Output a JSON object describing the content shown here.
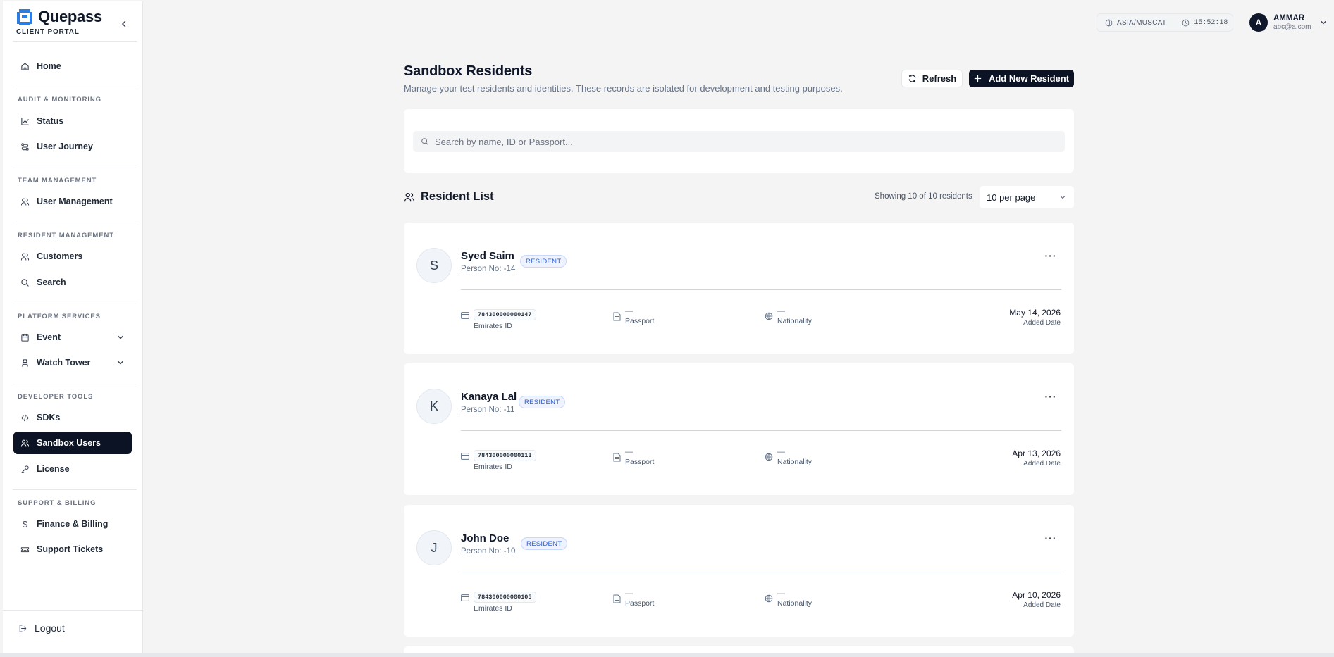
{
  "brand": {
    "name": "Quepass",
    "subtitle": "CLIENT PORTAL"
  },
  "sidebar": {
    "home": "Home",
    "sections": {
      "audit": "AUDIT & MONITORING",
      "team": "TEAM MANAGEMENT",
      "resident": "RESIDENT MANAGEMENT",
      "platform": "PLATFORM SERVICES",
      "developer": "DEVELOPER TOOLS",
      "support": "SUPPORT & BILLING"
    },
    "items": {
      "status": "Status",
      "user_journey": "User Journey",
      "user_management": "User Management",
      "customers": "Customers",
      "search": "Search",
      "event": "Event",
      "watch_tower": "Watch Tower",
      "sdks": "SDKs",
      "sandbox_users": "Sandbox Users",
      "license": "License",
      "finance_billing": "Finance & Billing",
      "support_tickets": "Support Tickets"
    },
    "active": "sandbox_users",
    "logout": "Logout"
  },
  "topbar": {
    "timezone": "ASIA/MUSCAT",
    "time": "15:52:18",
    "user": {
      "initial": "A",
      "name": "AMMAR",
      "email": "abc@a.com"
    }
  },
  "header": {
    "title": "Sandbox Residents",
    "subtitle": "Manage your test residents and identities. These records are isolated for development and testing purposes.",
    "refresh_label": "Refresh",
    "add_label": "Add New Resident"
  },
  "search": {
    "placeholder": "Search by name, ID or Passport..."
  },
  "list": {
    "title": "Resident List",
    "showing": "Showing 10 of 10 residents",
    "per_page": "10 per page"
  },
  "residents": [
    {
      "initial": "S",
      "name": "Syed Saim",
      "person_no": "Person No: -14",
      "badge": "RESIDENT",
      "emirates_id": "784300000000147",
      "emirates_id_label": "Emirates ID",
      "passport": "—",
      "passport_label": "Passport",
      "nationality": "—",
      "nationality_label": "Nationality",
      "added_date": "May 14, 2026",
      "added_date_label": "Added Date"
    },
    {
      "initial": "K",
      "name": "Kanaya Lal",
      "person_no": "Person No: -11",
      "badge": "RESIDENT",
      "emirates_id": "784300000000113",
      "emirates_id_label": "Emirates ID",
      "passport": "—",
      "passport_label": "Passport",
      "nationality": "—",
      "nationality_label": "Nationality",
      "added_date": "Apr 13, 2026",
      "added_date_label": "Added Date"
    },
    {
      "initial": "J",
      "name": "John Doe",
      "person_no": "Person No: -10",
      "badge": "RESIDENT",
      "emirates_id": "784300000000105",
      "emirates_id_label": "Emirates ID",
      "passport": "—",
      "passport_label": "Passport",
      "nationality": "—",
      "nationality_label": "Nationality",
      "added_date": "Apr 10, 2026",
      "added_date_label": "Added Date"
    }
  ],
  "colors": {
    "primary_dark": "#0b1324",
    "badge_text": "#2f5fd0",
    "badge_bg": "#eef3ff",
    "page_bg": "#f4f4f5"
  },
  "icons": {
    "home": "home-icon",
    "status": "chart-line-icon",
    "user_journey": "route-icon",
    "user_management": "users-icon",
    "customers": "users-icon",
    "search": "search-icon",
    "event": "calendar-icon",
    "watch_tower": "tower-icon",
    "sdks": "code-icon",
    "sandbox_users": "users-icon",
    "license": "key-icon",
    "finance_billing": "dollar-icon",
    "support_tickets": "ticket-icon",
    "logout": "logout-icon"
  }
}
